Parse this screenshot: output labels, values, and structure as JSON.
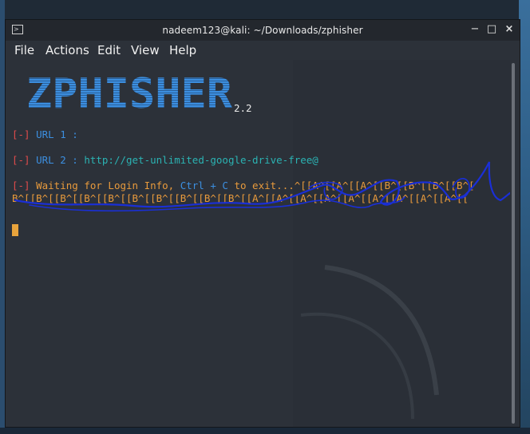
{
  "window": {
    "title": "nadeem123@kali: ~/Downloads/zphisher",
    "controls": {
      "minimize": "−",
      "maximize": "□",
      "close": "×"
    }
  },
  "menu": [
    "File",
    "Actions",
    "Edit",
    "View",
    "Help"
  ],
  "terminal": {
    "logo_text": "ZPHISHER",
    "version": "2.2",
    "lines": [
      {
        "prefix": "[-]",
        "label": "URL 1 :",
        "value": ""
      },
      {
        "prefix": "[-]",
        "label": "URL 2 :",
        "value": "http://get-unlimited-google-drive-free@"
      },
      {
        "prefix": "[-]",
        "label": "Waiting for Login Info,",
        "ctrl": "Ctrl + C",
        "tail": "to exit...",
        "junk": "^[[A^[[A^[[A^[[B^[[B^[[B^[[B^["
      },
      {
        "junk": "B^[[B^[[B^[[B^[[B^[[B^[[B^[[B^[[B^[[B^[[A^[[A^[[A^[[A^[[A^[[A^[[A^[[A^[[A^[["
      }
    ]
  },
  "colors": {
    "prompt_bracket": "#e14b4b",
    "label": "#3c8fe0",
    "value": "#2bb3b3",
    "waiting": "#e89a3c",
    "scribble": "#1a2fd6"
  }
}
